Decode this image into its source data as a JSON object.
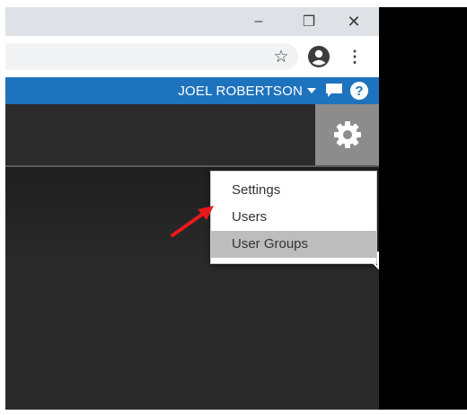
{
  "window_controls": {
    "minimize": "–",
    "restore": "❐",
    "close": "✕"
  },
  "browser_toolbar": {
    "bookmark_icon": "star-icon",
    "profile_icon": "account-circle-icon",
    "menu_icon": "more-vert-icon",
    "star_glyph": "☆",
    "kebab_glyph": "⋮"
  },
  "app_nav": {
    "user_name": "JOEL ROBERTSON",
    "chat_icon": "chat-bubble-icon",
    "help_icon": "help-icon",
    "help_glyph": "?",
    "color": "#1e73be"
  },
  "settings_button": {
    "icon": "gear-icon"
  },
  "dropdown_menu": {
    "items": [
      {
        "label": "Settings"
      },
      {
        "label": "Users"
      },
      {
        "label": "User Groups",
        "highlighted": true
      }
    ]
  },
  "annotation": {
    "arrow_color": "#e8191c",
    "points_to": "Settings"
  }
}
